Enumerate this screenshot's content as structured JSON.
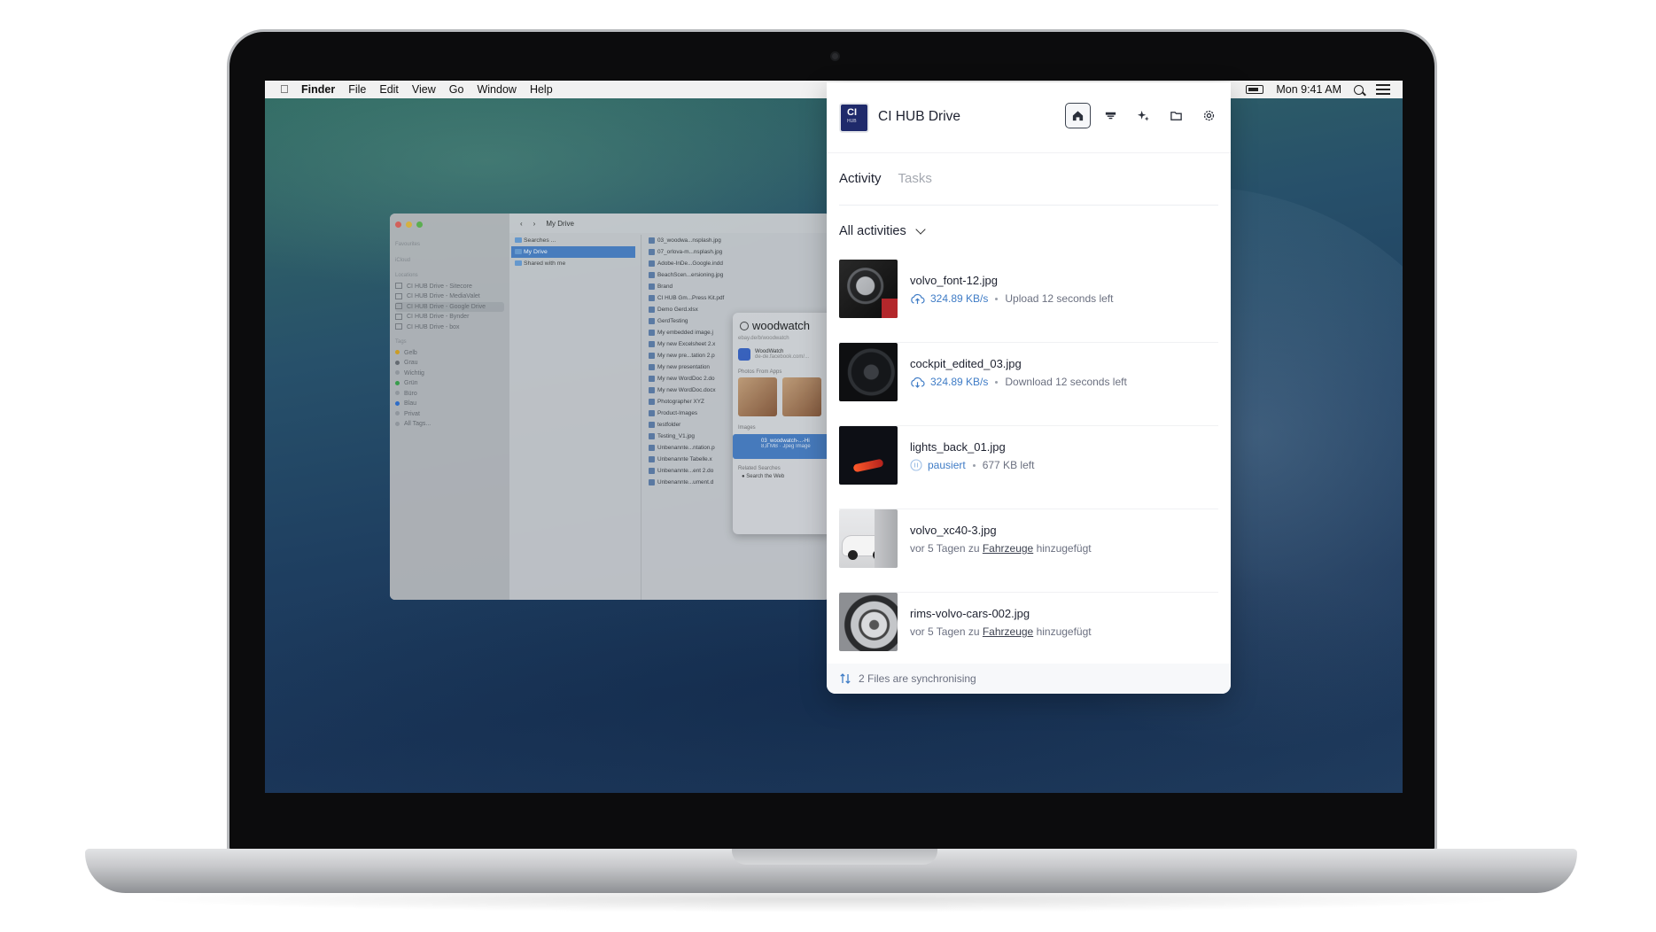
{
  "menubar": {
    "items": [
      "Finder",
      "File",
      "Edit",
      "View",
      "Go",
      "Window",
      "Help"
    ],
    "clock": "Mon 9:41 AM"
  },
  "finder": {
    "location": "My Drive",
    "sidebar_sections": [
      "Favourites",
      "iCloud",
      "Locations",
      "Tags"
    ],
    "locations": [
      "CI HUB Drive - Sitecore",
      "CI HUB Drive - MediaValet",
      "CI HUB Drive - Google Drive",
      "CI HUB Drive - Bynder",
      "CI HUB Drive - box"
    ],
    "tags": [
      {
        "label": "Gelb",
        "color": "#d9a320"
      },
      {
        "label": "Grau",
        "color": "#6b6e73"
      },
      {
        "label": "Wichtig",
        "color": "#9a9da2"
      },
      {
        "label": "Grün",
        "color": "#3aa34a"
      },
      {
        "label": "Büro",
        "color": "#9a9da2"
      },
      {
        "label": "Blau",
        "color": "#2f6fd0"
      },
      {
        "label": "Privat",
        "color": "#9a9da2"
      },
      {
        "label": "All Tags...",
        "color": "#9a9da2"
      }
    ],
    "col1": [
      "Searches ...",
      "My Drive",
      "Shared with me"
    ],
    "col2": [
      "03_woodwa...nsplash.jpg",
      "07_orlova-m...nsplash.jpg",
      "Adobe-InDe...Google.indd",
      "BeachScen...ersioning.jpg",
      "Brand",
      "CI HUB Gm...Press Kit.pdf",
      "Demo Gerd.xlsx",
      "GerdTesting",
      "My embedded image.j",
      "My new Excelsheet 2.x",
      "My new pre...tation 2.p",
      "My new presentation",
      "My new WordDoc 2.do",
      "My new WordDoc.docx",
      "Photographer XYZ",
      "Product-Images",
      "testfolder",
      "Testing_V1.jpg",
      "Unbenannte...ntation.p",
      "Unbenannte Tabelle.x",
      "Unbenannte...ent 2.do",
      "Unbenannte...ument.d"
    ],
    "spotlight": {
      "query": "woodwatch",
      "url": "ebay.de/b/woodwatch",
      "result_title": "WoodWatch",
      "result_url": "de-de.facebook.com/...",
      "photos_label": "Photos From Apps",
      "images_label": "Images",
      "highlight_name": "03_woodwatch-...-Hi",
      "highlight_meta": "8,8 MB · Jpeg Image",
      "related_label": "Related Searches",
      "web_label": "Search the Web"
    }
  },
  "panel": {
    "title": "CI HUB Drive",
    "logo_text": "CI",
    "logo_sub": "HUB",
    "tabs": [
      {
        "label": "Activity",
        "active": true
      },
      {
        "label": "Tasks",
        "active": false
      }
    ],
    "filter_label": "All activities",
    "items": [
      {
        "name": "volvo_font-12.jpg",
        "speed": "324.89 KB/s",
        "status": "Upload 12 seconds left",
        "kind": "upload"
      },
      {
        "name": "cockpit_edited_03.jpg",
        "speed": "324.89 KB/s",
        "status": "Download 12 seconds left",
        "kind": "download"
      },
      {
        "name": "lights_back_01.jpg",
        "speed": "pausiert",
        "status": "677 KB left",
        "kind": "paused"
      },
      {
        "name": "volvo_xc40-3.jpg",
        "prefix": "vor 5 Tagen zu",
        "folder": "Fahrzeuge",
        "suffix": "hinzugefügt",
        "kind": "added"
      },
      {
        "name": "rims-volvo-cars-002.jpg",
        "prefix": "vor 5 Tagen zu",
        "folder": "Fahrzeuge",
        "suffix": "hinzugefügt",
        "kind": "added"
      }
    ],
    "footer": "2 Files are synchronising",
    "accent": "#3f7cc6",
    "brand": "#1f2a6b"
  }
}
